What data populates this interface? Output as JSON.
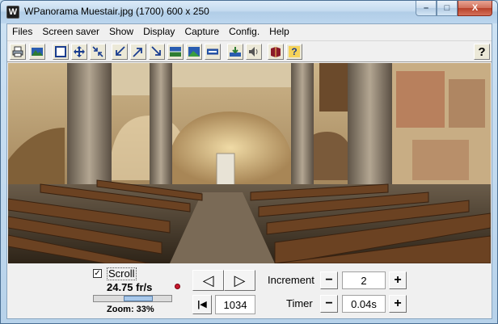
{
  "window": {
    "title": "WPanorama  Muestair.jpg  (1700) 600 x 250",
    "app_icon": "W",
    "min_label": "–",
    "max_label": "□",
    "close_label": "X"
  },
  "menu": [
    "Files",
    "Screen saver",
    "Show",
    "Display",
    "Capture",
    "Config.",
    "Help"
  ],
  "toolbar": {
    "icons": [
      "print-icon",
      "image-icon",
      "frame-icon",
      "move-icon",
      "shrink-icon",
      "zoom-out-icon",
      "zoom-in-icon",
      "zoom-corner-icon",
      "adjust-horizon-icon",
      "picture-area-icon",
      "strip-icon",
      "trim-icon",
      "sound-icon",
      "book-icon",
      "help-doc-icon",
      "help-question-icon"
    ],
    "help_label": "?",
    "help_doc_label": "?"
  },
  "controls": {
    "scroll_checked": true,
    "check_glyph": "✓",
    "scroll_label": "Scroll",
    "framerate": "24.75 fr/s",
    "zoom": "Zoom: 33%",
    "scroll_position": 0.62,
    "prev_glyph": "◁",
    "next_glyph": "▷",
    "first_glyph": "|◀",
    "position_value": "1034",
    "increment_label": "Increment",
    "increment_value": "2",
    "timer_label": "Timer",
    "timer_value": "0.04s",
    "minus_label": "−",
    "plus_label": "+"
  },
  "colors": {
    "accent": "#a8c8ea",
    "close_red": "#c8533c"
  }
}
